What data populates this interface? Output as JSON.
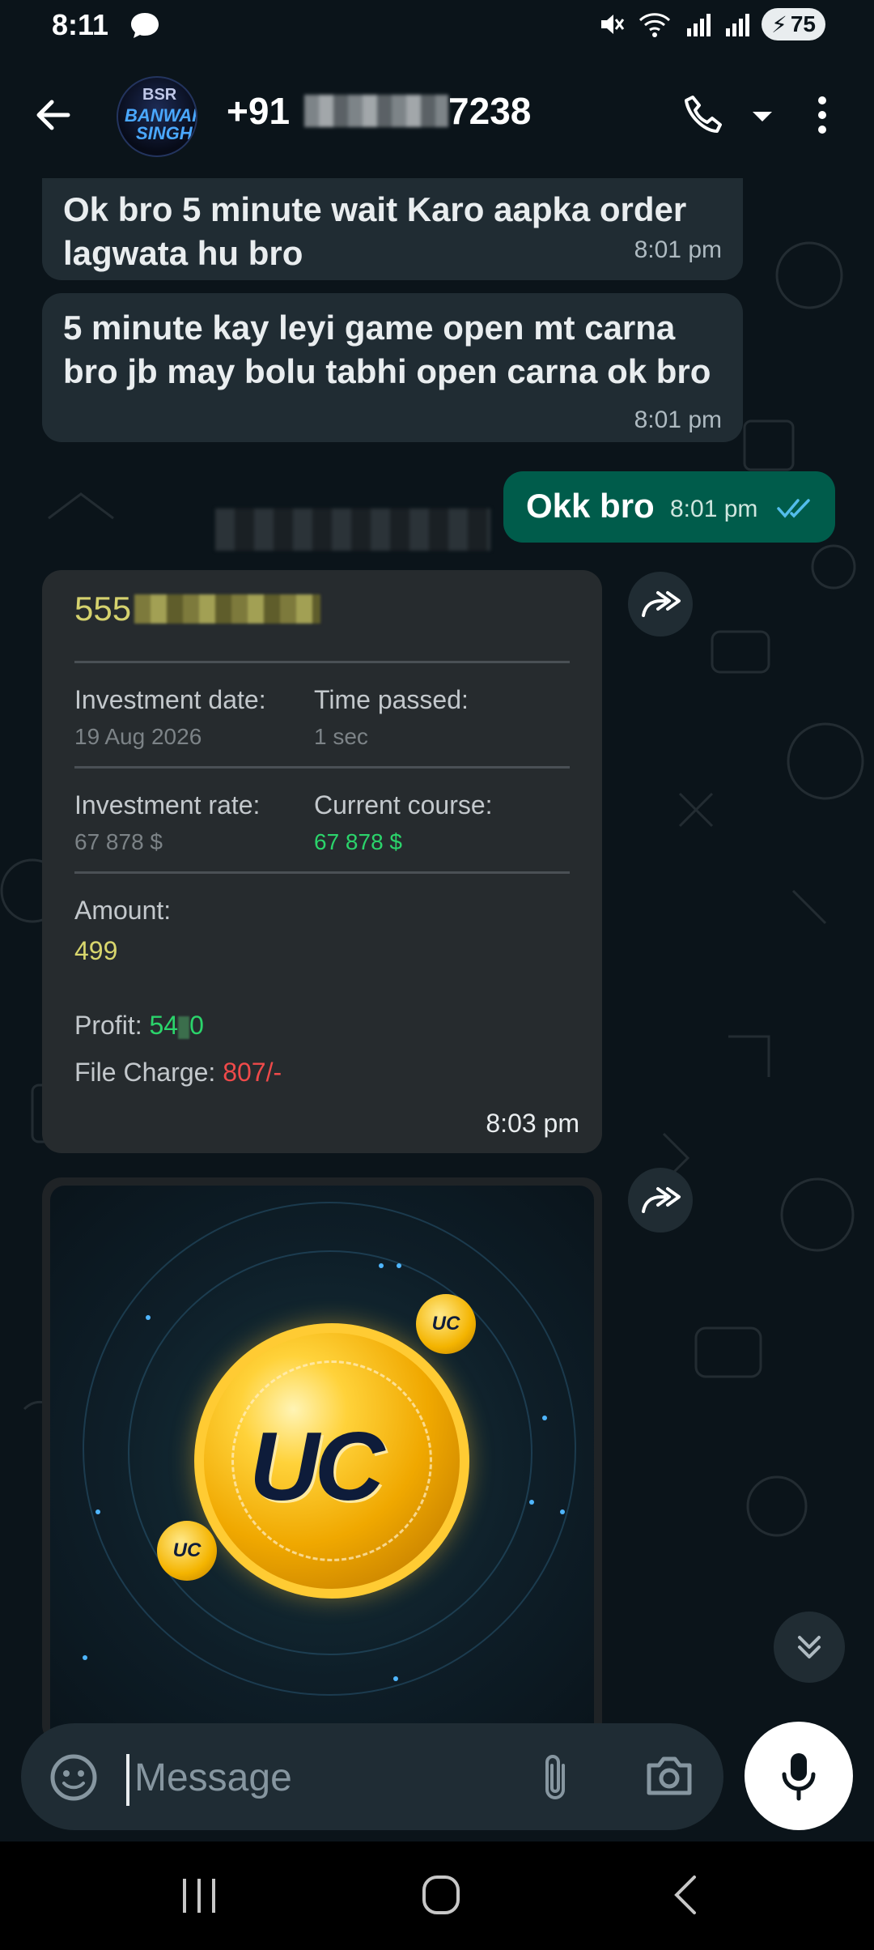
{
  "status_bar": {
    "time": "8:11",
    "battery": "75"
  },
  "header": {
    "contact_prefix": "+91",
    "contact_suffix": "7238"
  },
  "messages": [
    {
      "text_line1": "Ok bro 5 minute wait Karo aapka order",
      "text_line2": "lagwata hu bro",
      "time": "8:01 pm"
    },
    {
      "text_line1": "5 minute kay leyi game open mt carna",
      "text_line2": "bro jb may bolu tabhi open carna ok bro",
      "time": "8:01 pm"
    },
    {
      "text": "Okk bro",
      "time": "8:01 pm",
      "outgoing": true
    }
  ],
  "card": {
    "id_prefix": "555",
    "investment_date_label": "Investment date:",
    "investment_date": "19 Aug 2026",
    "time_passed_label": "Time passed:",
    "time_passed": "1 sec",
    "investment_rate_label": "Investment rate:",
    "investment_rate": "67 878 $",
    "current_course_label": "Current course:",
    "current_course": "67 878 $",
    "amount_label": "Amount:",
    "amount": "499",
    "profit_label": "Profit:",
    "profit_prefix": "54",
    "profit_suffix": "0",
    "file_charge_label": "File Charge:",
    "file_charge": "807/-",
    "time": "8:03 pm"
  },
  "image_card": {
    "main_text": "UC",
    "mini_text": "UC"
  },
  "composer": {
    "placeholder": "Message"
  },
  "colors": {
    "accent": "#005c4b",
    "incoming": "#202c33",
    "green": "#2bd46b",
    "red": "#ef4a4a",
    "yellow": "#d8d66d",
    "tick": "#53bdeb"
  },
  "icons": [
    "back-arrow-icon",
    "phone-icon",
    "more-vert-icon",
    "forward-icon",
    "double-chevron-down-icon",
    "emoji-icon",
    "attach-icon",
    "camera-icon",
    "mic-icon",
    "read-receipt-icon"
  ]
}
